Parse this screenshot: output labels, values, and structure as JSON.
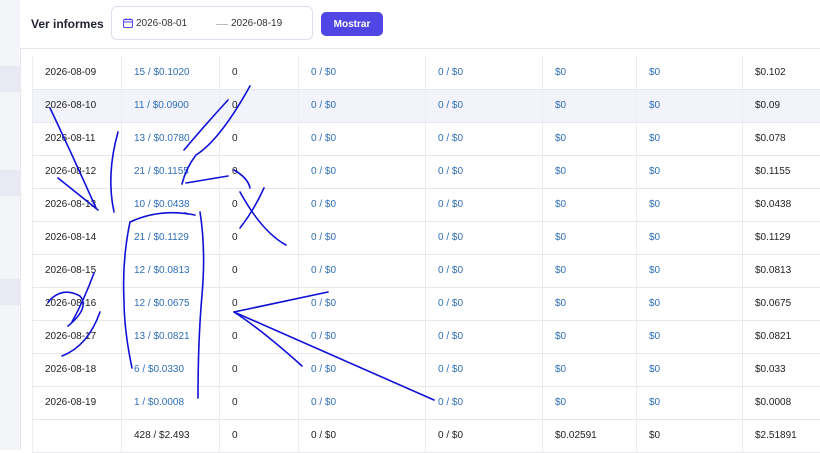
{
  "header": {
    "title": "Ver informes",
    "date_from": "2026-08-01",
    "date_to": "2026-08-19",
    "show_label": "Mostrar"
  },
  "table": {
    "rows": [
      [
        "2026-08-09",
        "15 / $0.1020",
        "0",
        "0 / $0",
        "0 / $0",
        "$0",
        "$0",
        "$0.102"
      ],
      [
        "2026-08-10",
        "11 / $0.0900",
        "0",
        "0 / $0",
        "0 / $0",
        "$0",
        "$0",
        "$0.09"
      ],
      [
        "2026-08-11",
        "13 / $0.0780",
        "0",
        "0 / $0",
        "0 / $0",
        "$0",
        "$0",
        "$0.078"
      ],
      [
        "2026-08-12",
        "21 / $0.1155",
        "0",
        "0 / $0",
        "0 / $0",
        "$0",
        "$0",
        "$0.1155"
      ],
      [
        "2026-08-13",
        "10 / $0.0438",
        "0",
        "0 / $0",
        "0 / $0",
        "$0",
        "$0",
        "$0.0438"
      ],
      [
        "2026-08-14",
        "21 / $0.1129",
        "0",
        "0 / $0",
        "0 / $0",
        "$0",
        "$0",
        "$0.1129"
      ],
      [
        "2026-08-15",
        "12 / $0.0813",
        "0",
        "0 / $0",
        "0 / $0",
        "$0",
        "$0",
        "$0.0813"
      ],
      [
        "2026-08-16",
        "12 / $0.0675",
        "0",
        "0 / $0",
        "0 / $0",
        "$0",
        "$0",
        "$0.0675"
      ],
      [
        "2026-08-17",
        "13 / $0.0821",
        "0",
        "0 / $0",
        "0 / $0",
        "$0",
        "$0",
        "$0.0821"
      ],
      [
        "2026-08-18",
        "6 / $0.0330",
        "0",
        "0 / $0",
        "0 / $0",
        "$0",
        "$0",
        "$0.033"
      ],
      [
        "2026-08-19",
        "1 / $0.0008",
        "0",
        "0 / $0",
        "0 / $0",
        "$0",
        "$0",
        "$0.0008"
      ]
    ],
    "totals": [
      "",
      "428 / $2.493",
      "0",
      "0 / $0",
      "0 / $0",
      "$0.02591",
      "$0",
      "$2.51891"
    ]
  },
  "colors": {
    "accent": "#4f46e5",
    "link": "#2f6fb6",
    "ink": "#1010d8",
    "highlight_row": "#f2f3fb"
  },
  "icons": {
    "date": "calendar-icon"
  }
}
